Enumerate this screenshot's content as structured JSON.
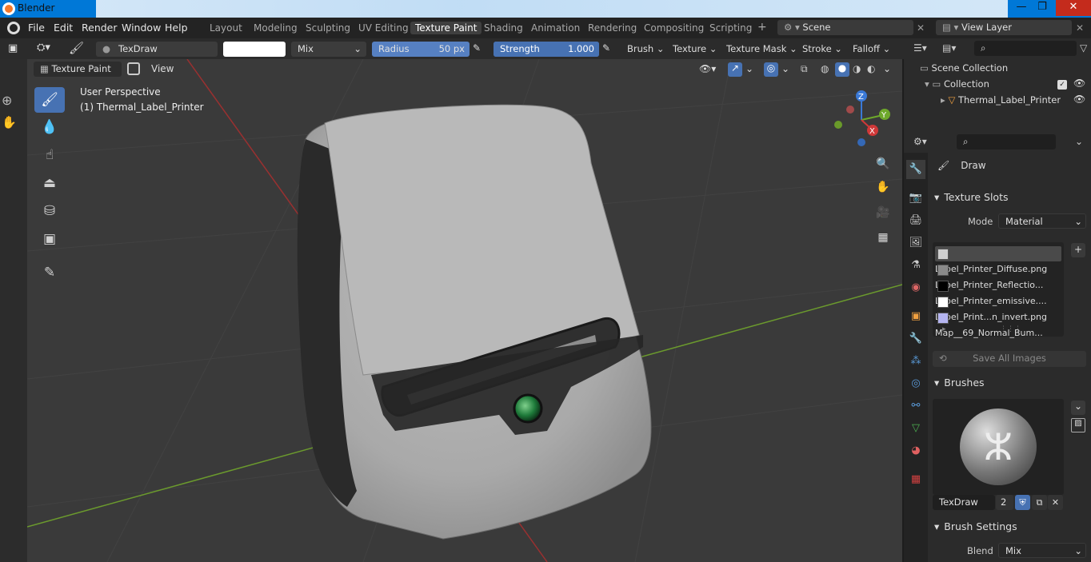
{
  "app": {
    "title": "Blender"
  },
  "os_buttons": {
    "minimize": "—",
    "maximize": "❐",
    "close": "✕"
  },
  "menu": {
    "items": [
      "File",
      "Edit",
      "Render",
      "Window",
      "Help"
    ]
  },
  "workspaces": {
    "tabs": [
      "Layout",
      "Modeling",
      "Sculpting",
      "UV Editing",
      "Texture Paint",
      "Shading",
      "Animation",
      "Rendering",
      "Compositing",
      "Scripting"
    ],
    "active": "Texture Paint",
    "add_label": "+"
  },
  "scene": {
    "name": "Scene",
    "view_layer": "View Layer"
  },
  "toolbar": {
    "brush_name": "TexDraw",
    "blend": "Mix",
    "radius_label": "Radius",
    "radius_value": "50 px",
    "strength_label": "Strength",
    "strength_value": "1.000",
    "strength_fraction": 1.0,
    "menus": [
      "Brush",
      "Texture",
      "Texture Mask",
      "Stroke",
      "Falloff"
    ]
  },
  "viewport_header": {
    "mode": "Texture Paint",
    "view": "View"
  },
  "viewport": {
    "perspective": "User Perspective",
    "object_label": "(1) Thermal_Label_Printer",
    "axes": {
      "x": "X",
      "y": "Y",
      "z": "Z"
    },
    "bg_color": "#3a3a3a"
  },
  "outliner": {
    "root": "Scene Collection",
    "collection": "Collection",
    "object": "Thermal_Label_Printer"
  },
  "properties": {
    "tool_name": "Draw",
    "texture_slots": {
      "header": "Texture Slots",
      "mode_label": "Mode",
      "mode_value": "Material",
      "slots": [
        {
          "name": "Label_Printer_Diffuse.png",
          "color": "#cfcfcf"
        },
        {
          "name": "Label_Printer_Reflectio...",
          "color": "#8a8a8a"
        },
        {
          "name": "Label_Printer_emissive....",
          "color": "#000000"
        },
        {
          "name": "Label_Print...n_invert.png",
          "color": "#ffffff"
        },
        {
          "name": "Map__69_Normal_Bum...",
          "color": "#b4b4f0"
        }
      ],
      "save_all": "Save All Images"
    },
    "brushes": {
      "header": "Brushes",
      "name": "TexDraw",
      "users": "2"
    },
    "brush_settings": {
      "header": "Brush Settings",
      "blend_label": "Blend",
      "blend_value": "Mix"
    }
  },
  "accent_color": "#4772b3"
}
